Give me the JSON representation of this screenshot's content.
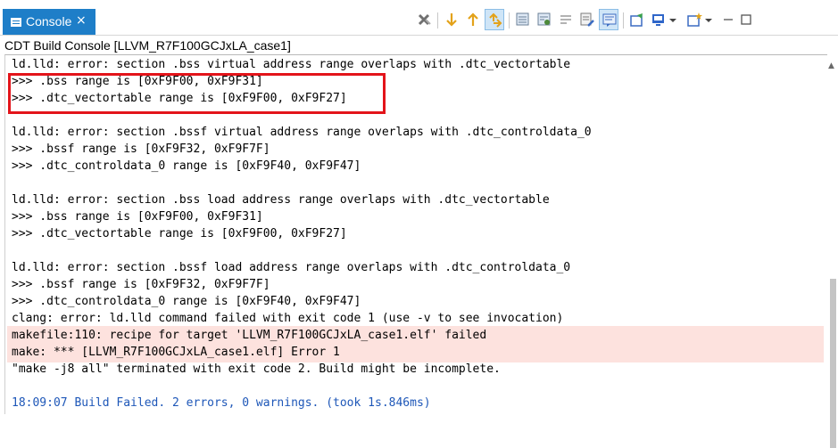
{
  "tab": {
    "label": "Console",
    "close_glyph": "×",
    "icon": "console-icon"
  },
  "toolbar": {
    "icons": [
      "remove-launches-icon",
      "scroll-down-icon",
      "scroll-up-icon",
      "scroll-lock-icon",
      "copy-build-log-icon",
      "open-build-log-icon",
      "word-wrap-icon",
      "clear-console-icon",
      "display-console-icon",
      "pin-console-icon",
      "new-console-icon",
      "open-console-icon",
      "minimize-icon",
      "maximize-icon"
    ]
  },
  "console": {
    "title": "CDT Build Console [LLVM_R7F100GCJxLA_case1]",
    "lines": [
      {
        "text": "ld.lld: error: section .bss virtual address range overlaps with .dtc_vectortable",
        "style": "normal"
      },
      {
        "text": ">>> .bss range is [0xF9F00, 0xF9F31]",
        "style": "normal"
      },
      {
        "text": ">>> .dtc_vectortable range is [0xF9F00, 0xF9F27]",
        "style": "normal"
      },
      {
        "text": "",
        "style": "normal"
      },
      {
        "text": "ld.lld: error: section .bssf virtual address range overlaps with .dtc_controldata_0",
        "style": "normal"
      },
      {
        "text": ">>> .bssf range is [0xF9F32, 0xF9F7F]",
        "style": "normal"
      },
      {
        "text": ">>> .dtc_controldata_0 range is [0xF9F40, 0xF9F47]",
        "style": "normal"
      },
      {
        "text": "",
        "style": "normal"
      },
      {
        "text": "ld.lld: error: section .bss load address range overlaps with .dtc_vectortable",
        "style": "normal"
      },
      {
        "text": ">>> .bss range is [0xF9F00, 0xF9F31]",
        "style": "normal"
      },
      {
        "text": ">>> .dtc_vectortable range is [0xF9F00, 0xF9F27]",
        "style": "normal"
      },
      {
        "text": "",
        "style": "normal"
      },
      {
        "text": "ld.lld: error: section .bssf load address range overlaps with .dtc_controldata_0",
        "style": "normal"
      },
      {
        "text": ">>> .bssf range is [0xF9F32, 0xF9F7F]",
        "style": "normal"
      },
      {
        "text": ">>> .dtc_controldata_0 range is [0xF9F40, 0xF9F47]",
        "style": "normal"
      },
      {
        "text": "clang: error: ld.lld command failed with exit code 1 (use -v to see invocation)",
        "style": "normal"
      },
      {
        "text": "makefile:110: recipe for target 'LLVM_R7F100GCJxLA_case1.elf' failed",
        "style": "error-highlight"
      },
      {
        "text": "make: *** [LLVM_R7F100GCJxLA_case1.elf] Error 1",
        "style": "error-highlight"
      },
      {
        "text": "\"make -j8 all\" terminated with exit code 2. Build might be incomplete.",
        "style": "normal"
      },
      {
        "text": "",
        "style": "normal"
      },
      {
        "text": "18:09:07 Build Failed. 2 errors, 0 warnings. (took 1s.846ms)",
        "style": "info"
      }
    ]
  },
  "colors": {
    "tab_active": "#1e7ec8",
    "callout": "#e3141a",
    "error_highlight": "#fde2de",
    "info_text": "#1e57b8"
  }
}
